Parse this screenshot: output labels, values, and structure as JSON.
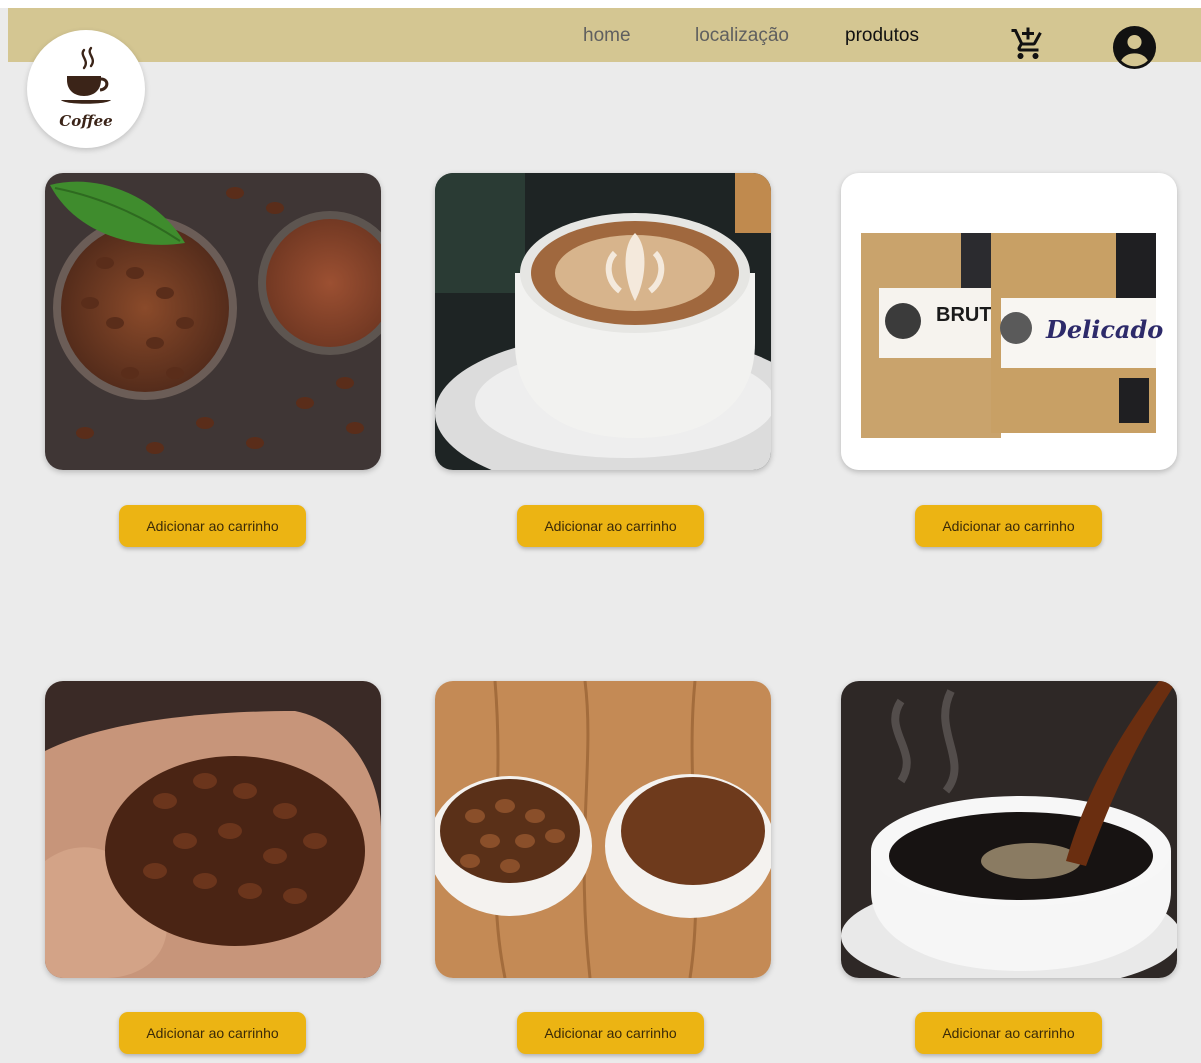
{
  "nav": {
    "links": [
      {
        "label": "home",
        "active": false
      },
      {
        "label": "localização",
        "active": false
      },
      {
        "label": "produtos",
        "active": true
      }
    ],
    "cart_icon": "add-to-cart-icon",
    "user_icon": "account-circle-icon"
  },
  "logo": {
    "text": "Coffee",
    "icon": "coffee-cup-icon"
  },
  "products": [
    {
      "image": "coffee beans and ground coffee in bowls",
      "button": "Adicionar ao carrinho"
    },
    {
      "image": "cappuccino with latte art",
      "button": "Adicionar ao carrinho"
    },
    {
      "image": "Bruto and Delicado coffee packages",
      "brand_a": "BRUT",
      "brand_b": "Delicado",
      "button": "Adicionar ao carrinho"
    },
    {
      "image": "hands holding coffee beans",
      "button": "Adicionar ao carrinho"
    },
    {
      "image": "bowls of coffee beans and ground coffee on wood",
      "button": "Adicionar ao carrinho"
    },
    {
      "image": "coffee being poured into white cup",
      "button": "Adicionar ao carrinho"
    }
  ],
  "colors": {
    "navbar": "#d4c692",
    "background": "#ebebeb",
    "button": "#ecb413"
  }
}
